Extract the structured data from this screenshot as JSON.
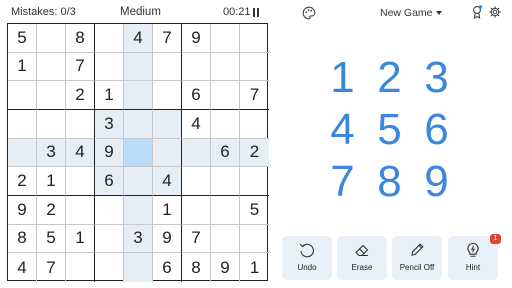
{
  "header": {
    "mistakes": "Mistakes: 0/3",
    "difficulty": "Medium",
    "timer": "00:21"
  },
  "menu": {
    "new_game": "New Game"
  },
  "board": {
    "rows": [
      [
        "5",
        "",
        "8",
        "",
        "4",
        "7",
        "9",
        "",
        ""
      ],
      [
        "1",
        "",
        "7",
        "",
        "",
        "",
        "",
        "",
        ""
      ],
      [
        "",
        "",
        "2",
        "1",
        "",
        "",
        "6",
        "",
        "7"
      ],
      [
        "",
        "",
        "",
        "3",
        "",
        "",
        "4",
        "",
        ""
      ],
      [
        "",
        "3",
        "4",
        "9",
        "",
        "",
        "",
        "6",
        "2"
      ],
      [
        "2",
        "1",
        "",
        "6",
        "",
        "4",
        "",
        "",
        ""
      ],
      [
        "9",
        "2",
        "",
        "",
        "",
        "1",
        "",
        "",
        "5"
      ],
      [
        "8",
        "5",
        "1",
        "",
        "3",
        "9",
        "7",
        "",
        ""
      ],
      [
        "4",
        "7",
        "",
        "",
        "",
        "6",
        "8",
        "9",
        "1"
      ]
    ],
    "selected": {
      "row": 4,
      "col": 4
    }
  },
  "numpad": {
    "keys": [
      "1",
      "2",
      "3",
      "4",
      "5",
      "6",
      "7",
      "8",
      "9"
    ]
  },
  "tools": {
    "undo": "Undo",
    "erase": "Erase",
    "pencil": "Pencil Off",
    "hint": "Hint",
    "hint_count": "1"
  },
  "colors": {
    "accent": "#3a87e0",
    "highlight": "#e6edf5",
    "selected": "#b9dcfb",
    "badge": "#e0453a"
  },
  "icons": [
    "theme-icon",
    "trophy-icon",
    "gear-icon",
    "pause-icon",
    "undo-icon",
    "eraser-icon",
    "pencil-icon",
    "lightbulb-icon"
  ]
}
